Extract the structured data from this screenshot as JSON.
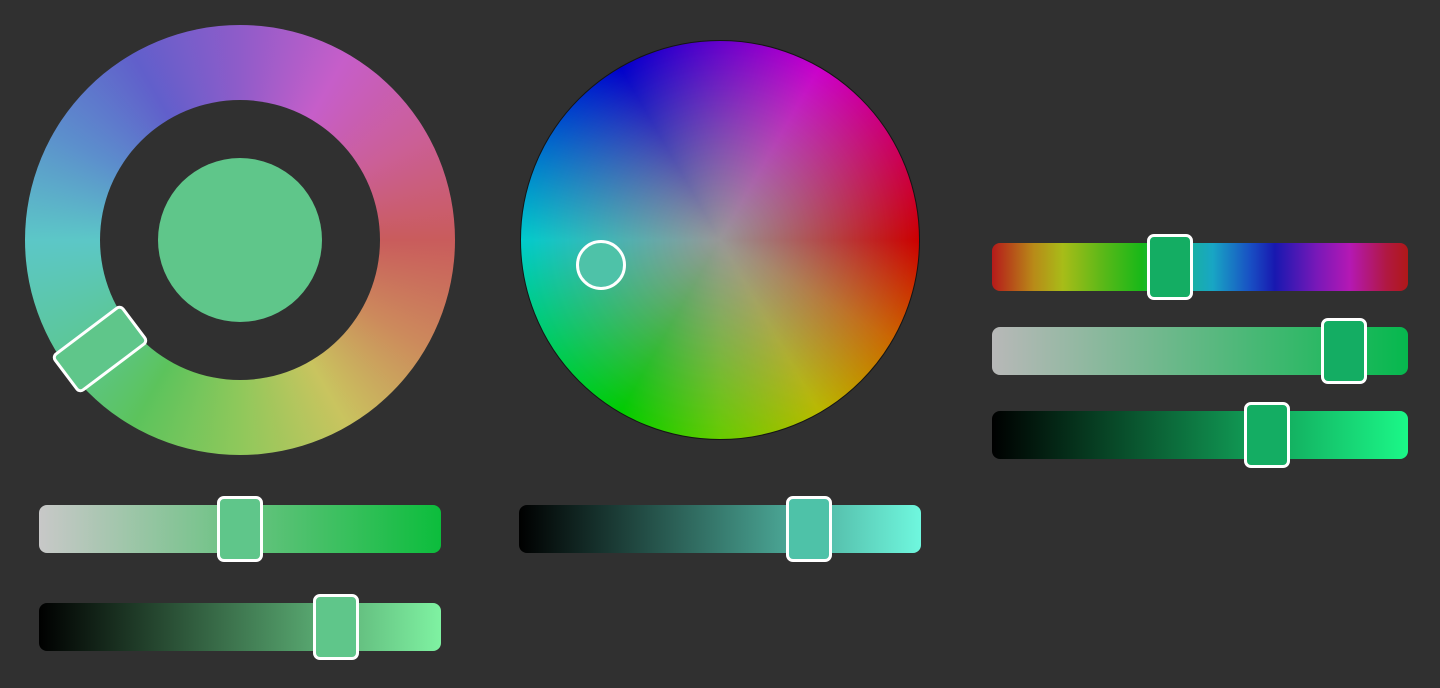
{
  "colors": {
    "background": "#303030",
    "ring_picker_color": "#5fc68a",
    "wheel_picker_color": "#4ec2a8",
    "hsv_picker_color": "#14ad63",
    "handle_border": "#ffffff"
  },
  "ring_picker": {
    "hue_handle_angle_deg": 217,
    "saturation_level": 0.5,
    "value_level": 0.77
  },
  "wheel_picker": {
    "cursor_hue_deg": 173,
    "cursor_saturation": 0.6,
    "value_level": 0.75
  },
  "hsv_sliders": {
    "hue_level": 0.42,
    "saturation_level": 0.89,
    "value_level": 0.68
  }
}
